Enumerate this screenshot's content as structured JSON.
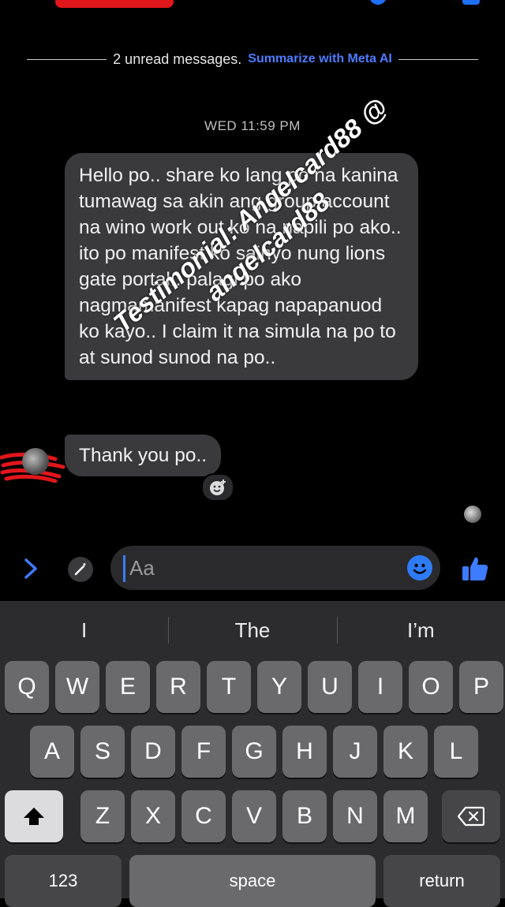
{
  "status": {
    "unread_text": "2 unread messages.",
    "summarize_link": "Summarize with Meta AI"
  },
  "thread": {
    "timestamp": "WED 11:59 PM",
    "messages": [
      {
        "text": "Hello po.. share ko lang po na kanina tumawag sa akin ang group account na wino work out ko na napili po ako.. ito po manifest ko sainyo nung lions gate portal.. palagi po ako nagmamanifest kapag napapanuod ko kayo.. I claim it na simula na po to at sunod sunod na po.."
      },
      {
        "text": "Thank you po.."
      }
    ]
  },
  "watermark": {
    "line1": "Testimonial: Angelcard88 @",
    "line2": "angelcard88"
  },
  "composer": {
    "placeholder": "Aa"
  },
  "keyboard": {
    "suggestions": [
      "I",
      "The",
      "I’m"
    ],
    "row1": [
      "Q",
      "W",
      "E",
      "R",
      "T",
      "Y",
      "U",
      "I",
      "O",
      "P"
    ],
    "row2": [
      "A",
      "S",
      "D",
      "F",
      "G",
      "H",
      "J",
      "K",
      "L"
    ],
    "row3": [
      "Z",
      "X",
      "C",
      "V",
      "B",
      "N",
      "M"
    ],
    "numbers_label": "123",
    "space_label": "space",
    "return_label": "return"
  },
  "colors": {
    "accent": "#3d7bff",
    "bubble": "#3a3a3c",
    "redaction": "#e0161b"
  },
  "icons": [
    "chevron-right-icon",
    "magic-wand-icon",
    "emoji-icon",
    "thumbs-up-icon",
    "add-reaction-icon",
    "shift-icon",
    "backspace-icon"
  ]
}
